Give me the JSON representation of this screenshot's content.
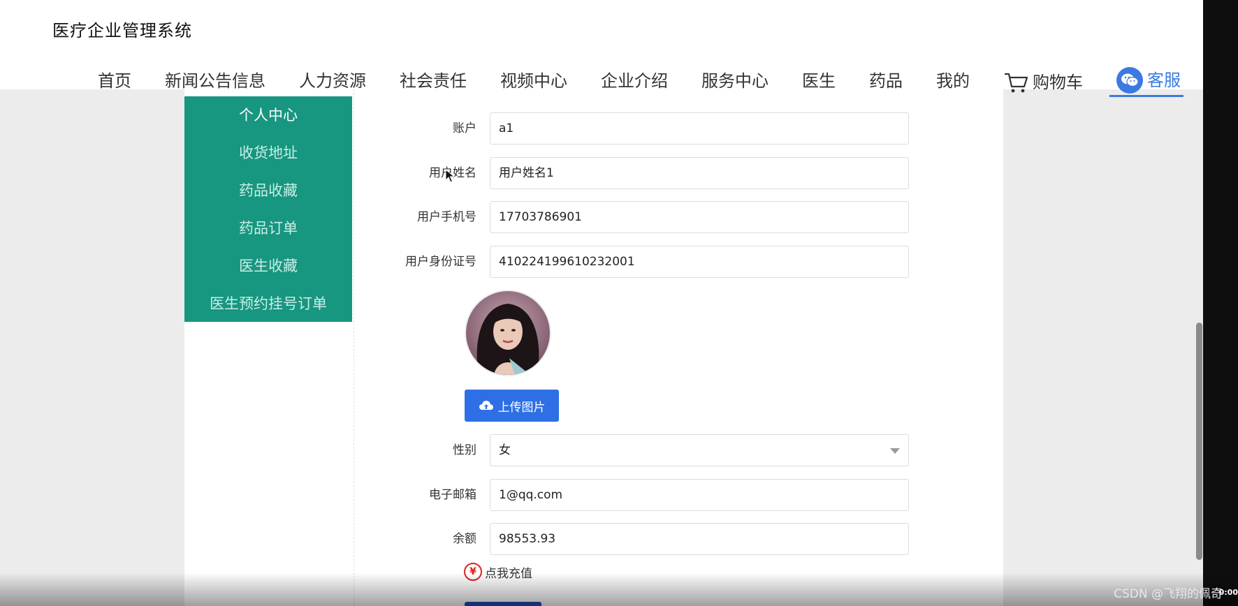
{
  "header": {
    "title": "医疗企业管理系统"
  },
  "nav": {
    "items": [
      "首页",
      "新闻公告信息",
      "人力资源",
      "社会责任",
      "视频中心",
      "企业介绍",
      "服务中心",
      "医生",
      "药品",
      "我的"
    ],
    "cart_label": "购物车",
    "service_label": "客服"
  },
  "sidebar": {
    "items": [
      "个人中心",
      "收货地址",
      "药品收藏",
      "药品订单",
      "医生收藏",
      "医生预约挂号订单"
    ],
    "active_index": 0
  },
  "form": {
    "account": {
      "label": "账户",
      "value": "a1"
    },
    "name": {
      "label": "用户姓名",
      "value": "用户姓名1"
    },
    "phone": {
      "label": "用户手机号",
      "value": "17703786901"
    },
    "id_card": {
      "label": "用户身份证号",
      "value": "410224199610232001"
    },
    "upload_label": "上传图片",
    "gender": {
      "label": "性别",
      "value": "女"
    },
    "email": {
      "label": "电子邮箱",
      "value": "1@qq.com"
    },
    "balance": {
      "label": "余额",
      "value": "98553.93"
    },
    "recharge_label": "点我充值",
    "recharge_icon": "¥"
  },
  "overlay": {
    "watermark": "CSDN @飞翔的佩奇",
    "timestamp": "0:00"
  },
  "colors": {
    "sidebar_bg": "#179680",
    "accent_blue": "#2e6fe6",
    "service_blue": "#3b7ae0",
    "page_bg": "#ececec"
  }
}
